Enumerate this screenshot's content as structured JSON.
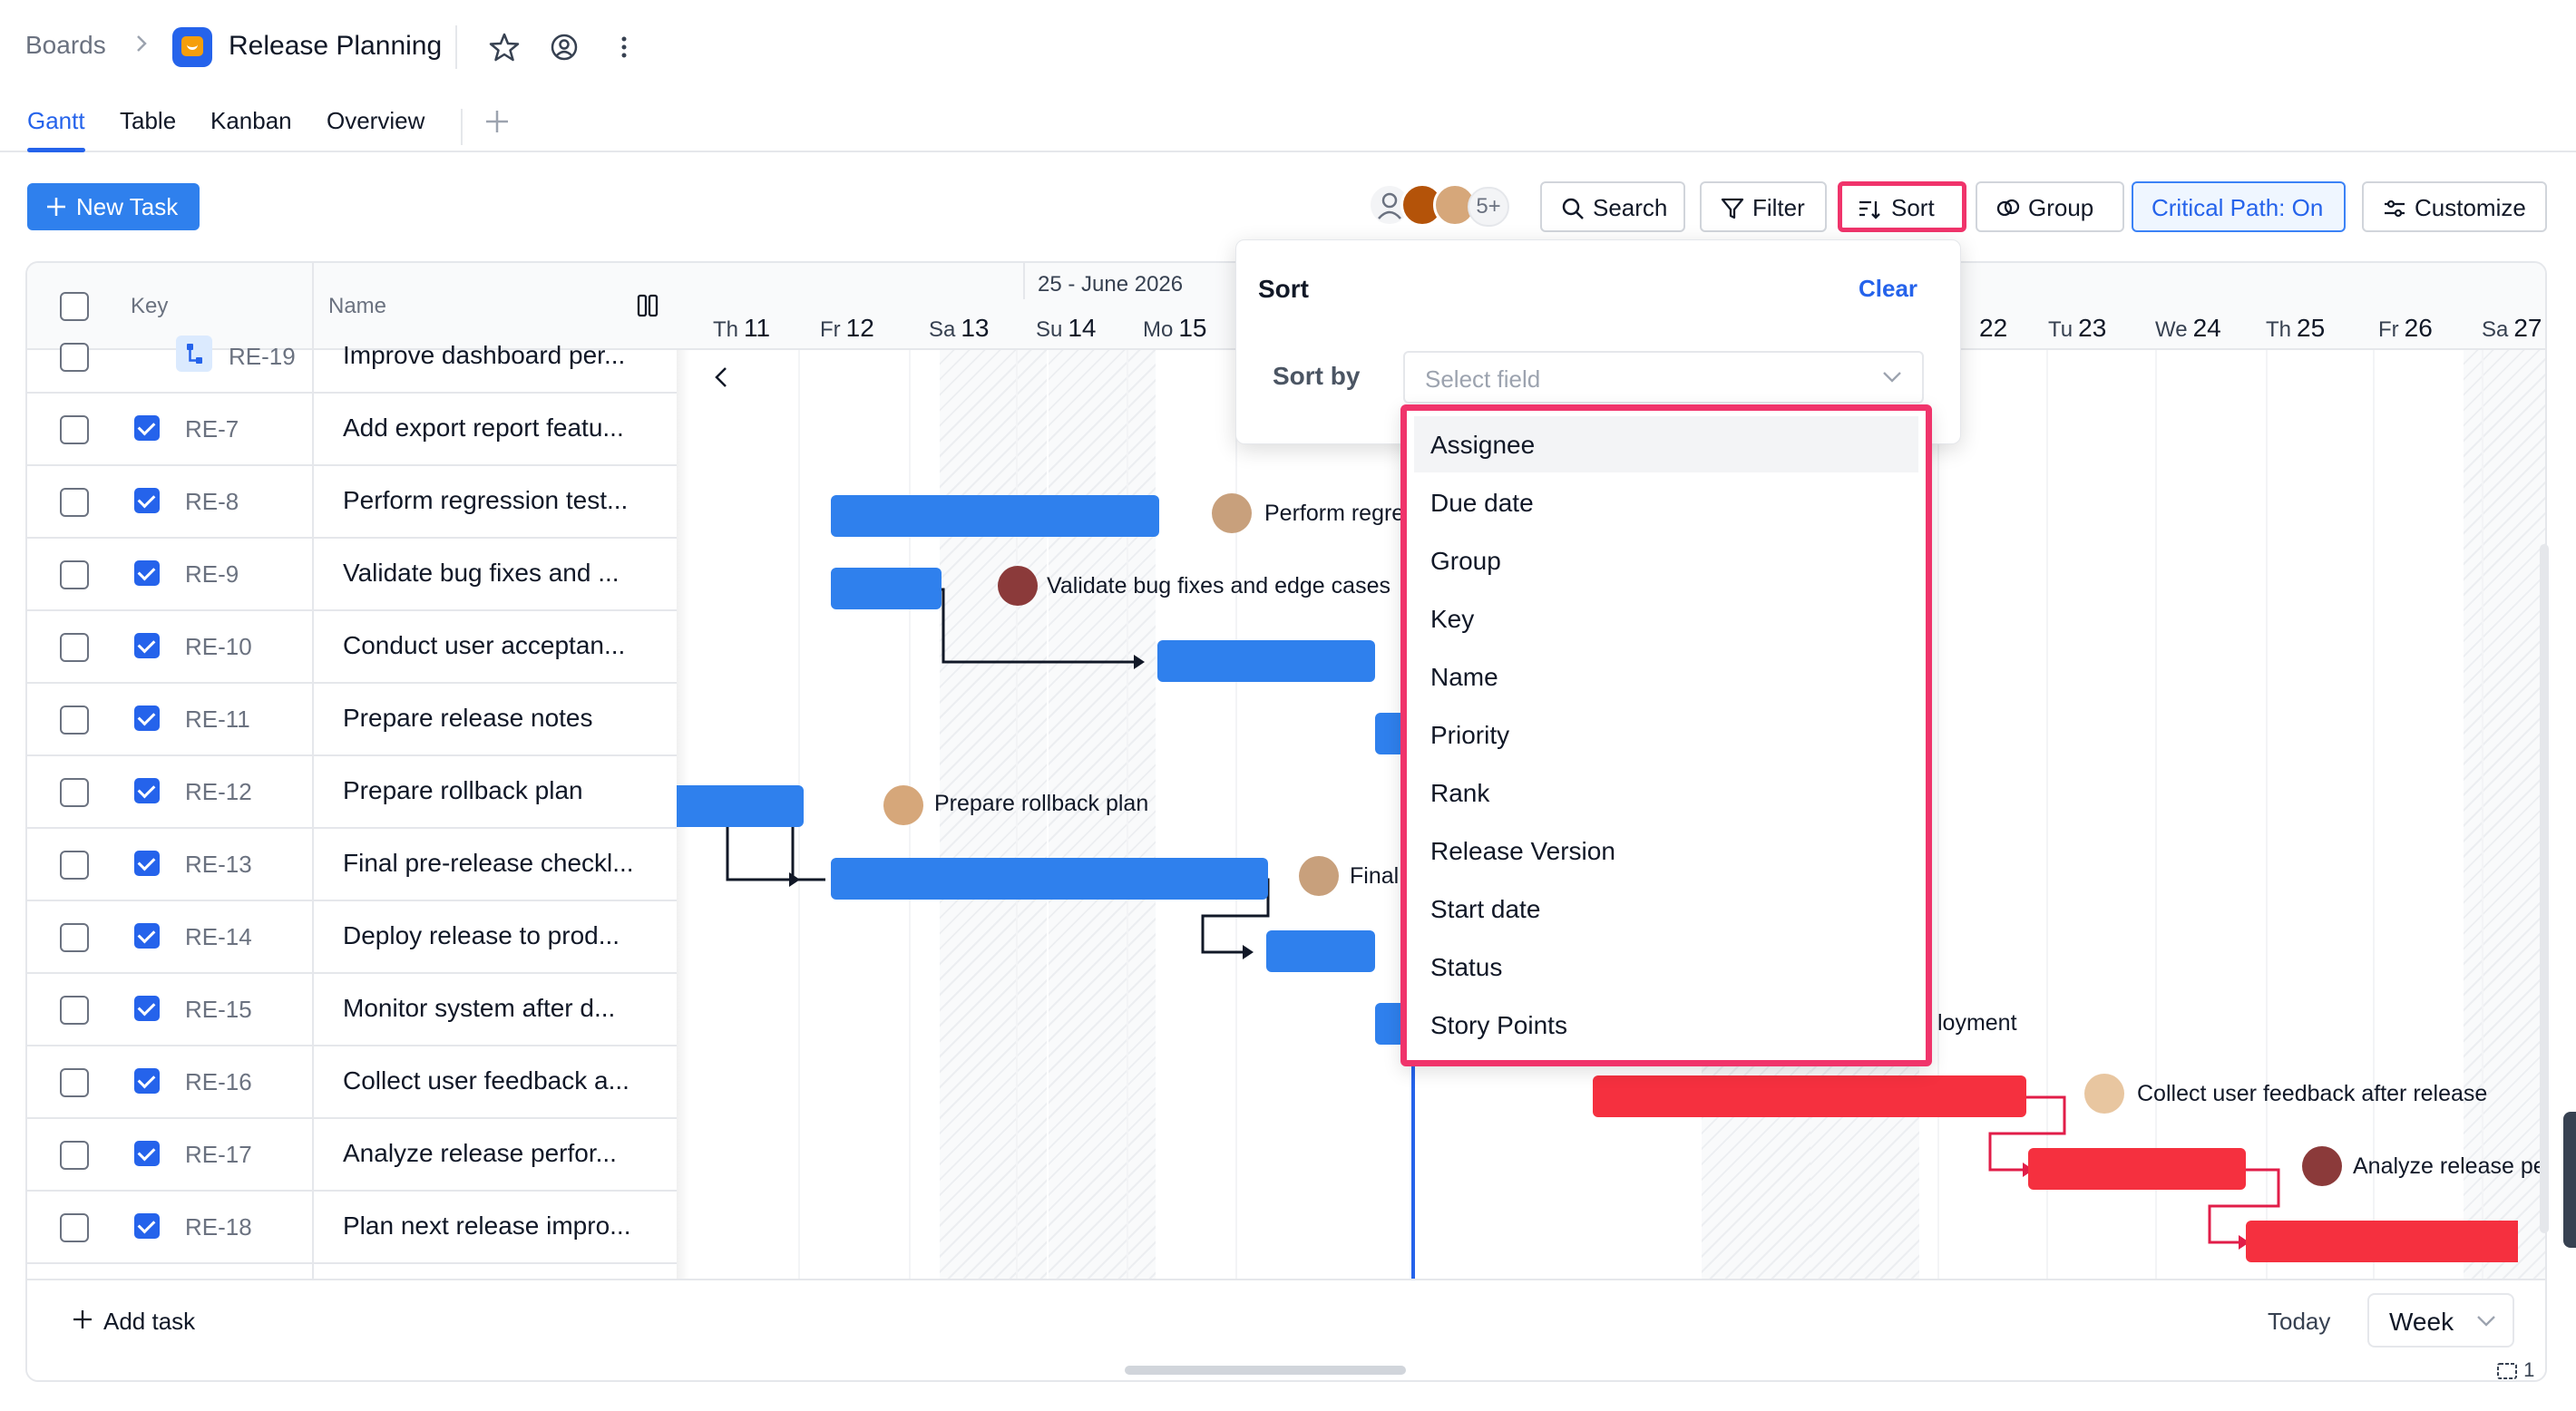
{
  "breadcrumb": {
    "root": "Boards",
    "board": "Release Planning"
  },
  "tabs": [
    {
      "label": "Gantt"
    },
    {
      "label": "Table"
    },
    {
      "label": "Kanban"
    },
    {
      "label": "Overview"
    }
  ],
  "toolbar": {
    "new_task": "New Task",
    "avatars_more": "5+",
    "search": "Search",
    "filter": "Filter",
    "sort": "Sort",
    "group": "Group",
    "critical_path": "Critical Path: On",
    "customize": "Customize"
  },
  "grid": {
    "headers": {
      "key": "Key",
      "name": "Name"
    },
    "rows": [
      {
        "key": "RE-19",
        "name": "Improve dashboard per...",
        "type": "subtask"
      },
      {
        "key": "RE-7",
        "name": "Add export report featu...",
        "type": "task"
      },
      {
        "key": "RE-8",
        "name": "Perform regression test...",
        "type": "task"
      },
      {
        "key": "RE-9",
        "name": "Validate bug fixes and ...",
        "type": "task"
      },
      {
        "key": "RE-10",
        "name": "Conduct user acceptan...",
        "type": "task"
      },
      {
        "key": "RE-11",
        "name": "Prepare release notes",
        "type": "task"
      },
      {
        "key": "RE-12",
        "name": "Prepare rollback plan",
        "type": "task"
      },
      {
        "key": "RE-13",
        "name": "Final pre-release checkl...",
        "type": "task"
      },
      {
        "key": "RE-14",
        "name": "Deploy release to prod...",
        "type": "task"
      },
      {
        "key": "RE-15",
        "name": "Monitor system after d...",
        "type": "task"
      },
      {
        "key": "RE-16",
        "name": "Collect user feedback a...",
        "type": "task"
      },
      {
        "key": "RE-17",
        "name": "Analyze release perfor...",
        "type": "task"
      },
      {
        "key": "RE-18",
        "name": "Plan next release impro...",
        "type": "task"
      }
    ]
  },
  "timeline": {
    "week_label": "25 - June 2026",
    "days": [
      {
        "dow": "Th",
        "num": "11"
      },
      {
        "dow": "Fr",
        "num": "12"
      },
      {
        "dow": "Sa",
        "num": "13"
      },
      {
        "dow": "Su",
        "num": "14"
      },
      {
        "dow": "Mo",
        "num": "15"
      },
      {
        "dow": "",
        "num": "22"
      },
      {
        "dow": "Tu",
        "num": "23"
      },
      {
        "dow": "We",
        "num": "24"
      },
      {
        "dow": "Th",
        "num": "25"
      },
      {
        "dow": "Fr",
        "num": "26"
      },
      {
        "dow": "Sa",
        "num": "27"
      }
    ],
    "bar_labels": {
      "re8": "Perform regress",
      "re9": "Validate bug fixes and edge cases",
      "re12": "Prepare rollback plan",
      "re13": "Final",
      "re15": "loyment",
      "re16": "Collect user feedback after release",
      "re17": "Analyze release perf"
    },
    "colors": {
      "normal": "#2f80ed",
      "critical": "#f5303f",
      "today": "#2563eb"
    }
  },
  "footer": {
    "add_task": "Add task",
    "today": "Today",
    "view": "Week",
    "page_indicator": "1"
  },
  "sort_popover": {
    "title": "Sort",
    "clear": "Clear",
    "sort_by_label": "Sort by",
    "select_placeholder": "Select field",
    "fields": [
      "Assignee",
      "Due date",
      "Group",
      "Key",
      "Name",
      "Priority",
      "Rank",
      "Release Version",
      "Start date",
      "Status",
      "Story Points"
    ]
  }
}
